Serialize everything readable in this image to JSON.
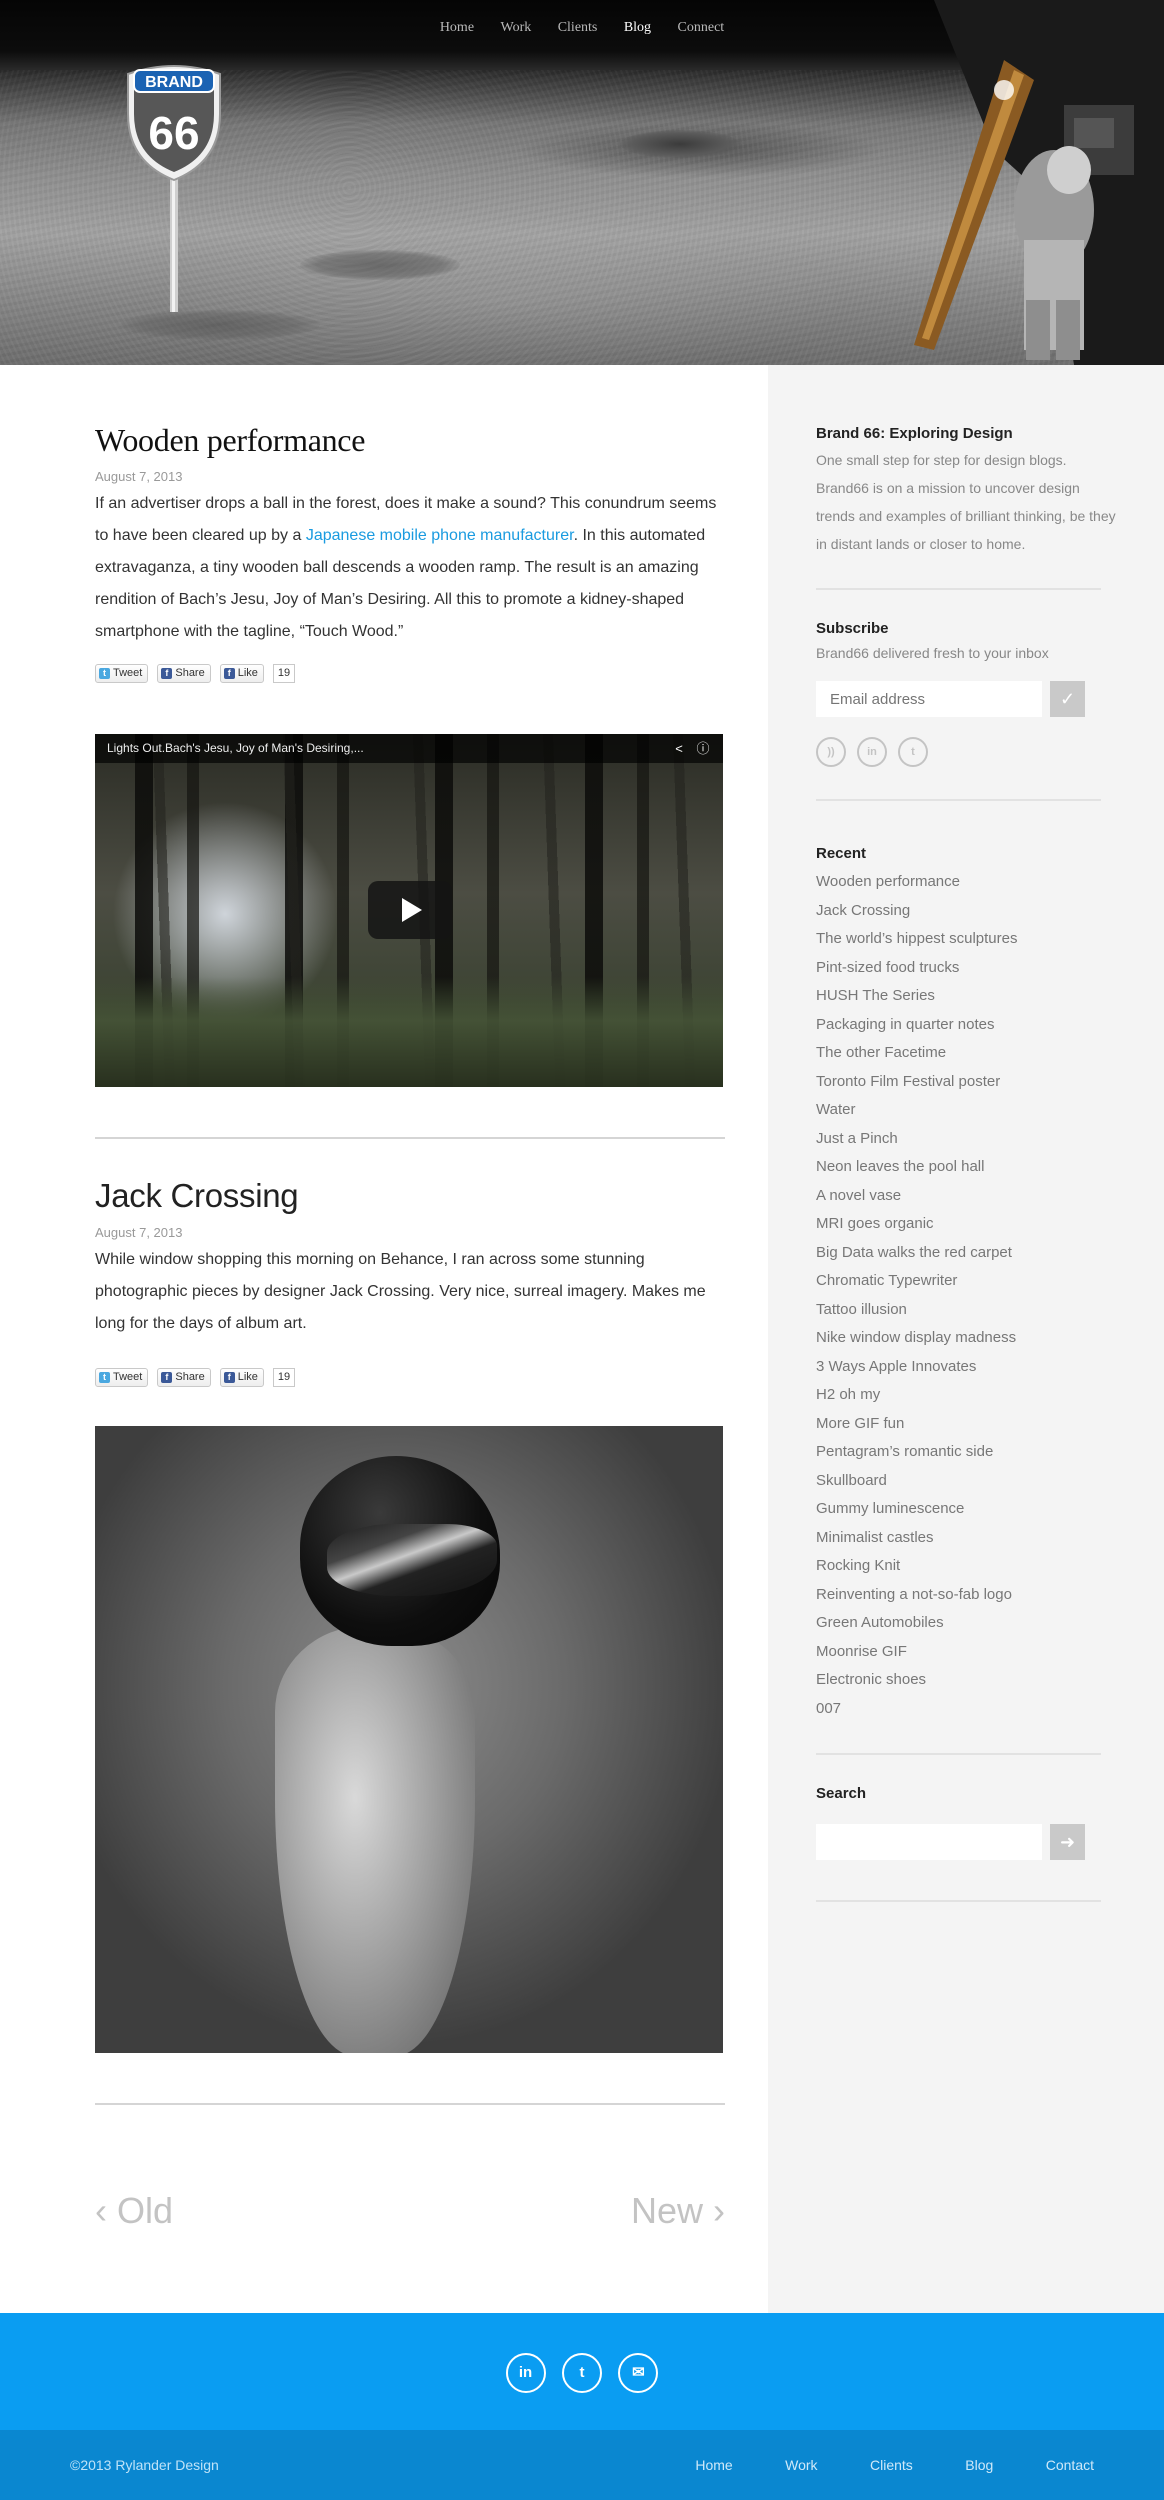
{
  "nav": {
    "items": [
      "Home",
      "Work",
      "Clients",
      "Blog",
      "Connect"
    ],
    "active": "Blog"
  },
  "logo": {
    "top_text": "BRAND",
    "number": "66"
  },
  "posts": [
    {
      "title": "Wooden performance",
      "date": "August 7, 2013",
      "body_before_link": "If an advertiser drops a ball in the forest, does it make a sound? This conundrum seems to have been cleared up by a ",
      "link_text": "Japanese mobile phone manufacturer",
      "body_after_link": ". In this automated extravaganza, a tiny wooden ball descends a wooden ramp. The result is an amazing rendition of Bach’s Jesu, Joy of Man’s Desiring. All this to promote a kidney-shaped smartphone with the tagline, “Touch Wood.”",
      "social": {
        "tweet": "Tweet",
        "share": "Share",
        "like": "Like",
        "count": "19"
      },
      "video_title": "Lights Out.Bach's  Jesu, Joy of Man's Desiring,..."
    },
    {
      "title": "Jack Crossing",
      "date": "August 7, 2013",
      "body": "While window shopping this morning on Behance, I ran across some stunning photographic pieces by designer Jack Crossing. Very nice, surreal imagery. Makes me long for the days of album art.",
      "social": {
        "tweet": "Tweet",
        "share": "Share",
        "like": "Like",
        "count": "19"
      }
    }
  ],
  "pager": {
    "old": "Old",
    "new": "New"
  },
  "sidebar": {
    "about_title": "Brand 66: Exploring Design",
    "about_text": "One small step for step for design blogs. Brand66 is on a mission to uncover design trends and examples of brilliant thinking, be they in distant lands or closer to home.",
    "subscribe_title": "Subscribe",
    "subscribe_text": "Brand66 delivered fresh to your inbox",
    "email_placeholder": "Email address",
    "recent_title": "Recent",
    "recent": [
      "Wooden performance",
      "Jack Crossing",
      "The world’s hippest sculptures",
      "Pint-sized food trucks",
      "HUSH The Series",
      "Packaging in quarter notes",
      "The other Facetime",
      "Toronto Film Festival poster",
      "Water",
      "Just a Pinch",
      "Neon leaves the pool hall",
      "A novel vase",
      "MRI goes organic",
      "Big Data walks the red carpet",
      "Chromatic Typewriter",
      "Tattoo illusion",
      "Nike window display madness",
      "3 Ways Apple Innovates",
      "H2 oh my",
      "More GIF fun",
      "Pentagram’s romantic side",
      "Skullboard",
      "Gummy luminescence",
      "Minimalist castles",
      "Rocking Knit",
      "Reinventing a not-so-fab logo",
      "Green Automobiles",
      "Moonrise GIF",
      "Electronic shoes",
      "007"
    ],
    "search_title": "Search"
  },
  "footer": {
    "copyright": "©2013 Rylander Design",
    "nav": [
      "Home",
      "Work",
      "Clients",
      "Blog",
      "Contact"
    ]
  },
  "colors": {
    "accent": "#1a9be0",
    "footer": "#0a9df2",
    "subfooter": "#0a87d0",
    "sidebar_bg": "#f4f4f4"
  }
}
